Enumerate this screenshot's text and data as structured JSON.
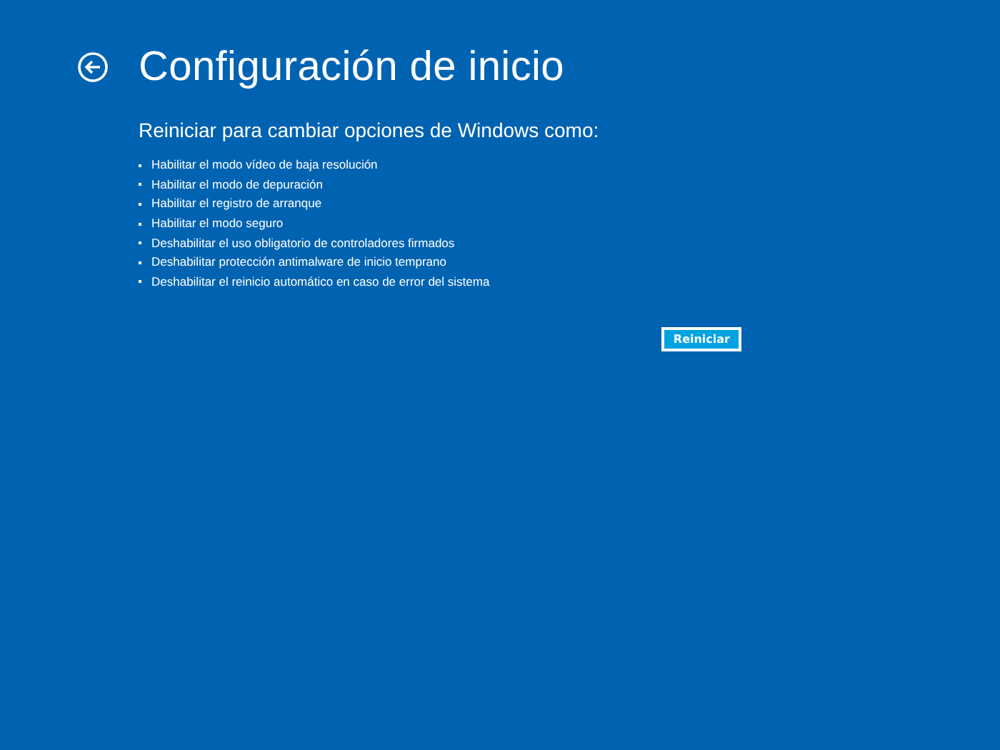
{
  "page": {
    "title": "Configuración de inicio",
    "subtitle": "Reiniciar para cambiar opciones de Windows como:"
  },
  "options": [
    "Habilitar el modo vídeo de baja resolución",
    "Habilitar el modo de depuración",
    "Habilitar el registro de arranque",
    "Habilitar el modo seguro",
    "Deshabilitar el uso obligatorio de controladores firmados",
    "Deshabilitar protección antimalware de inicio temprano",
    "Deshabilitar el reinicio automático en caso de error del sistema"
  ],
  "buttons": [
    {
      "label": "Reiniciar"
    }
  ]
}
